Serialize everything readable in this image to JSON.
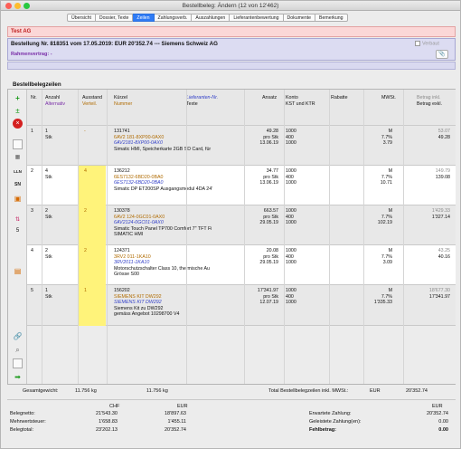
{
  "window": {
    "title": "Bestellbeleg: Ändern (12 von 12'462)"
  },
  "tabs": [
    "Übersicht",
    "Dossier, Texte",
    "Zeilen",
    "Zahlungsverb.",
    "Auszahlungen",
    "Lieferantenbewertung",
    "Dokumente",
    "Bemerkung"
  ],
  "active_tab": "Zeilen",
  "banner": {
    "text": "Test AG"
  },
  "order": {
    "title": "Bestellung Nr. 818351 vom 17.05.2019: EUR 20'352.74 --- Siemens Schweiz AG",
    "verbaut": "Verbaut",
    "rahmen": "Rahmenvertrag: -"
  },
  "section": {
    "title": "Bestellbelegzeilen"
  },
  "headers": {
    "nr": "Nr.",
    "anzahl": "Anzahl",
    "alternativ": "Alternativ",
    "ausstand": "Ausstand",
    "verteil": "Verteil.",
    "kuerzel": "Kürzel",
    "nummer": "Nummer",
    "texte": "Texte",
    "liefnr": "Lieferanten-Nr.",
    "ansatz": "Ansatz",
    "konto": "Konto",
    "kst": "KST und KTR",
    "rabatte": "Rabatte",
    "mwst": "MWSt.",
    "betrag_inkl": "Betrag inkl.",
    "betrag_exkl": "Betrag exkl."
  },
  "rows": [
    {
      "nr": "1",
      "anzahl": "1",
      "einheit": "Stk",
      "ausstand": "-",
      "kuerzel": "131741",
      "nummer": "6AV2 181-8XP00-0AX0",
      "lief": "6AV2181-8XP00-0AX0",
      "text": "Simatic HMI, Speicherkarte 2GB SD Card, für",
      "ansatz": "49.28",
      "pro": "pro Stk",
      "datum": "13.06.19",
      "konto": "1000",
      "kst": "400",
      "ktr": "1000",
      "mw1": "M",
      "mw2": "7.7%",
      "mw3": "3.79",
      "b1": "53.07",
      "b2": "49.28"
    },
    {
      "nr": "2",
      "anzahl": "4",
      "einheit": "Stk",
      "ausstand": "4",
      "kuerzel": "136212",
      "nummer": "6ES7132-6BD20-0BA0",
      "lief": "6ES7132-6BD20-0BA0",
      "text": "Simatic DP ET200SP Ausgangsmodul 4DA 24'",
      "ansatz": "34.77",
      "pro": "pro Stk",
      "datum": "13.06.19",
      "konto": "1000",
      "kst": "400",
      "ktr": "1000",
      "mw1": "M",
      "mw2": "7.7%",
      "mw3": "10.71",
      "b1": "149.79",
      "b2": "139.08"
    },
    {
      "nr": "3",
      "anzahl": "2",
      "einheit": "Stk",
      "ausstand": "2",
      "kuerzel": "130378",
      "nummer": "6AV2 124-0GC01-0AX0",
      "lief": "6AV2124-0GC01-0AX0",
      "text": "Simatic Touch Panel TP700 Comfort 7\" TFT Fi",
      "text2": "SIMATIC HMI",
      "ansatz": "663.57",
      "pro": "pro Stk",
      "datum": "29.05.19",
      "konto": "1000",
      "kst": "400",
      "ktr": "1000",
      "mw1": "M",
      "mw2": "7.7%",
      "mw3": "102.19",
      "b1": "1'429.33",
      "b2": "1'327.14"
    },
    {
      "nr": "4",
      "anzahl": "2",
      "einheit": "Stk",
      "ausstand": "2",
      "kuerzel": "124371",
      "nummer": "3RV2 011-1KA10",
      "lief": "3RV2011-1KA10",
      "text": "Motorschutzschalter Class 10, thermische Au",
      "text2": "Grösse S00",
      "ansatz": "20.08",
      "pro": "pro Stk",
      "datum": "29.05.19",
      "konto": "1000",
      "kst": "400",
      "ktr": "1000",
      "mw1": "M",
      "mw2": "7.7%",
      "mw3": "3.09",
      "b1": "43.25",
      "b2": "40.16"
    },
    {
      "nr": "5",
      "anzahl": "1",
      "einheit": "Stk",
      "ausstand": "1",
      "kuerzel": "156202",
      "nummer": "SIEMENS KIT DW292",
      "lief": "SIEMENS KIT DW292",
      "text": "Siemens Kit zu DW292",
      "text2": "gemäss Angebot 10298700 V4",
      "ansatz": "17'341.97",
      "pro": "pro Stk",
      "datum": "12.07.19",
      "konto": "1000",
      "kst": "400",
      "ktr": "1000",
      "mw1": "M",
      "mw2": "7.7%",
      "mw3": "1'335.33",
      "b1": "18'677.30",
      "b2": "17'341.97"
    }
  ],
  "toolbar": {
    "side_count": "5"
  },
  "footer": {
    "gewicht_label": "Gesamtgewicht:",
    "gewicht1": "11.756 kg",
    "gewicht2": "11.756 kg",
    "total_label": "Total Bestellbelegzeilen inkl. MWSt.:",
    "total_cur": "EUR",
    "total_val": "20'352.74"
  },
  "summary": {
    "chf": "CHF",
    "eur": "EUR",
    "netto_label": "Belegnetto:",
    "netto_chf": "21'543.30",
    "netto_eur": "18'897.63",
    "mwst_label": "Mehrwertsteuer:",
    "mwst_chf": "1'658.83",
    "mwst_eur": "1'455.11",
    "total_label": "Belegtotal:",
    "total_chf": "23'202.13",
    "total_eur": "20'352.74",
    "eur_right": "EUR",
    "erw_label": "Erwartete Zahlung:",
    "erw_val": "20'352.74",
    "geleistet_label": "Geleistete Zahlung(en):",
    "geleistet_val": "0.00",
    "fehl_label": "Fehlbetrag:",
    "fehl_val": "0.00"
  }
}
